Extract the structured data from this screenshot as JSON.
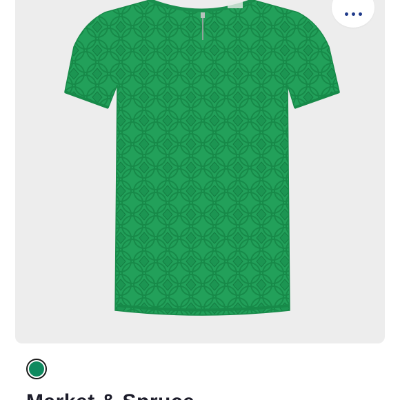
{
  "product": {
    "image_icon": "green-lace-tee-image",
    "brand": "Market & Spruce"
  },
  "actions": {
    "more_icon": "ellipsis-icon"
  },
  "colors": {
    "card_background": "#ededed",
    "shirt_green": "#22a05a",
    "shirt_green_dark": "#178a49",
    "more_dots": "#1f3a8a",
    "swatch_fill": "#0f8a5f"
  },
  "swatches": [
    {
      "color": "#0f8a5f",
      "selected": true
    }
  ]
}
